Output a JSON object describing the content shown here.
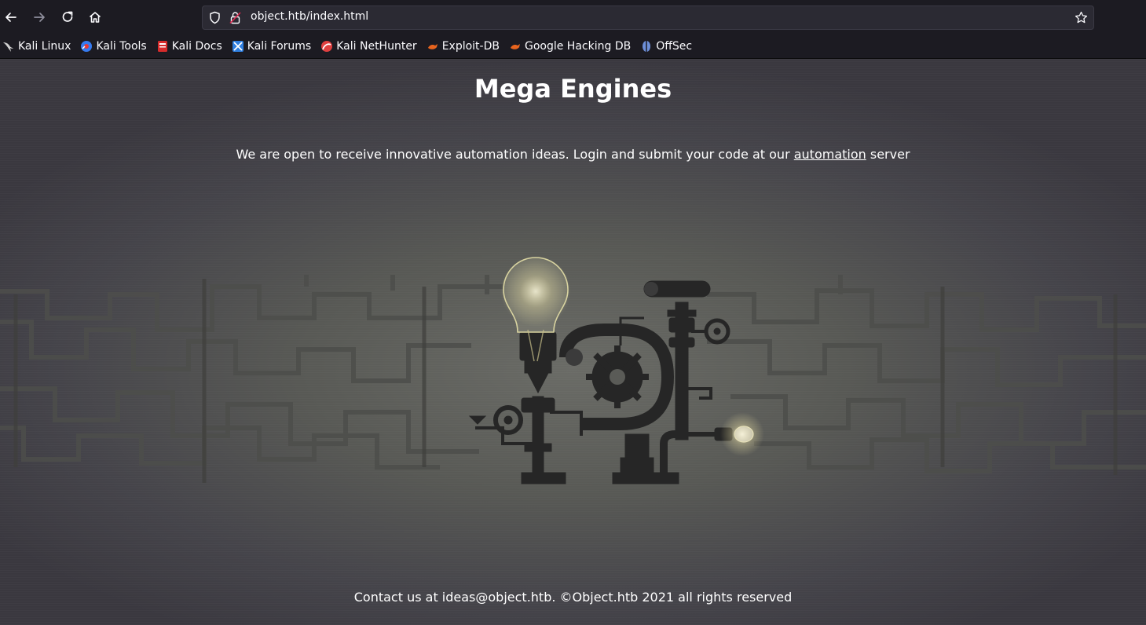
{
  "browser": {
    "url": "object.htb/index.html",
    "bookmarks": [
      {
        "label": "Kali Linux",
        "icon": "kali-dragon-icon",
        "color": "#e0e0e0"
      },
      {
        "label": "Kali Tools",
        "icon": "kali-tools-icon",
        "color": "#367bf0"
      },
      {
        "label": "Kali Docs",
        "icon": "kali-docs-icon",
        "color": "#e02f2f"
      },
      {
        "label": "Kali Forums",
        "icon": "kali-forums-icon",
        "color": "#2f7fe0"
      },
      {
        "label": "Kali NetHunter",
        "icon": "kali-nethunter-icon",
        "color": "#e04040"
      },
      {
        "label": "Exploit-DB",
        "icon": "exploit-db-icon",
        "color": "#e8641e"
      },
      {
        "label": "Google Hacking DB",
        "icon": "ghdb-icon",
        "color": "#e8641e"
      },
      {
        "label": "OffSec",
        "icon": "offsec-icon",
        "color": "#6d8fd8"
      }
    ]
  },
  "page": {
    "title": "Mega Engines",
    "lead_before": "We are open to receive innovative automation ideas. Login and submit your code at our ",
    "lead_link": "automation",
    "lead_after": " server",
    "footer": "Contact us at ideas@object.htb. ©Object.htb 2021 all rights reserved"
  }
}
